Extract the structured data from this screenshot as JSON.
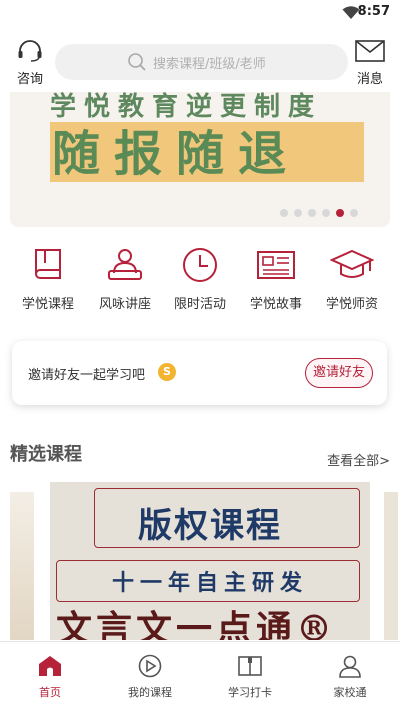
{
  "status_bar": {
    "time": "8:57"
  },
  "header": {
    "consult_label": "咨询",
    "search_placeholder": "搜索课程/班级/老师",
    "message_label": "消息"
  },
  "banner": {
    "top_text": "学悦教育逆更制度",
    "main_text": "随报随退",
    "dots_total": 6,
    "active_dot_index": 4
  },
  "nav": {
    "items": [
      {
        "label": "学悦课程",
        "icon": "book-icon"
      },
      {
        "label": "风咏讲座",
        "icon": "lecturer-icon"
      },
      {
        "label": "限时活动",
        "icon": "clock-icon"
      },
      {
        "label": "学悦故事",
        "icon": "newspaper-icon"
      },
      {
        "label": "学悦师资",
        "icon": "graduation-cap-icon"
      }
    ]
  },
  "invite": {
    "text": "邀请好友一起学习吧",
    "coin": "S",
    "button_label": "邀请好友"
  },
  "featured": {
    "title": "精选课程",
    "see_all": "查看全部>",
    "card": {
      "title": "版权课程",
      "subtitle": "十一年自主研发",
      "footer": "文言文一点通®"
    }
  },
  "tabbar": {
    "items": [
      {
        "label": "首页",
        "icon": "home-icon",
        "active": true
      },
      {
        "label": "我的课程",
        "icon": "play-circle-icon",
        "active": false
      },
      {
        "label": "学习打卡",
        "icon": "open-book-icon",
        "active": false
      },
      {
        "label": "家校通",
        "icon": "person-icon",
        "active": false
      }
    ]
  },
  "colors": {
    "accent": "#b5223a",
    "navy": "#203a68"
  }
}
